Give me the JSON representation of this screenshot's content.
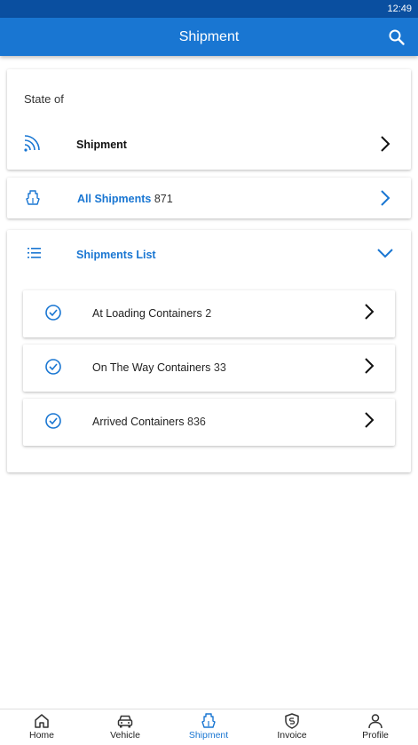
{
  "status_bar": {
    "time": "12:49"
  },
  "app_bar": {
    "title": "Shipment",
    "search_icon": "search-icon"
  },
  "state_card": {
    "label": "State of",
    "row": {
      "icon": "signal-waves-icon",
      "label": "Shipment"
    }
  },
  "all_shipments": {
    "icon": "ship-icon",
    "label": "All Shipments",
    "count": "871"
  },
  "shipments_list": {
    "icon": "list-icon",
    "title": "Shipments List",
    "items": [
      {
        "label": "At Loading Containers",
        "count": "2"
      },
      {
        "label": "On The Way Containers",
        "count": "33"
      },
      {
        "label": "Arrived Containers",
        "count": "836"
      }
    ]
  },
  "bottom_nav": {
    "items": [
      {
        "label": "Home",
        "icon": "home-icon"
      },
      {
        "label": "Vehicle",
        "icon": "car-icon"
      },
      {
        "label": "Shipment",
        "icon": "ship-icon",
        "active": true
      },
      {
        "label": "Invoice",
        "icon": "shield-dollar-icon"
      },
      {
        "label": "Profile",
        "icon": "person-icon"
      }
    ]
  },
  "colors": {
    "primary": "#1976d2",
    "status_bar": "#0a4fa0",
    "background": "#ffffff",
    "text": "#212121"
  }
}
